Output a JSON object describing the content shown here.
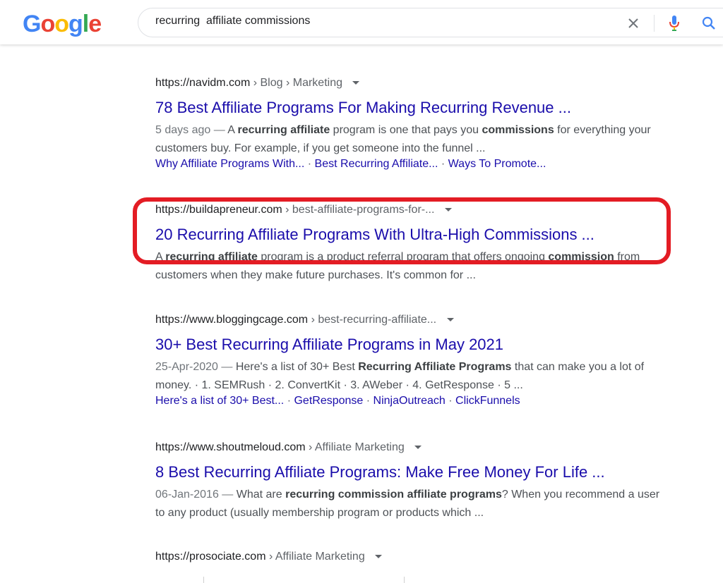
{
  "logo": {
    "letters": [
      "G",
      "o",
      "o",
      "g",
      "l",
      "e"
    ]
  },
  "search": {
    "query": "recurring  affiliate commissions"
  },
  "colors": {
    "link": "#1a0dab",
    "highlight": "#e31c24"
  },
  "results": [
    {
      "url": "https://navidm.com",
      "path": " › Blog › Marketing",
      "title": "78 Best Affiliate Programs For Making Recurring Revenue ...",
      "snippet": [
        {
          "t": "5 days ago — ",
          "date": true
        },
        {
          "t": "A "
        },
        {
          "t": "recurring affiliate",
          "b": true
        },
        {
          "t": " program is one that pays you "
        },
        {
          "t": "commissions",
          "b": true
        },
        {
          "t": " for everything your customers buy. For example, if you get someone into the funnel ..."
        }
      ],
      "sitelinks": [
        "Why Affiliate Programs With...",
        "Best Recurring Affiliate...",
        "Ways To Promote..."
      ]
    },
    {
      "url": "https://buildapreneur.com",
      "path": " › best-affiliate-programs-for-...",
      "title": "20 Recurring Affiliate Programs With Ultra-High Commissions ...",
      "snippet": [
        {
          "t": "A "
        },
        {
          "t": "recurring affiliate",
          "b": true
        },
        {
          "t": " program is a product referral program that offers ongoing "
        },
        {
          "t": "commission",
          "b": true
        },
        {
          "t": " from customers when they make future purchases. It's common for ..."
        }
      ],
      "sitelinks": []
    },
    {
      "url": "https://www.bloggingcage.com",
      "path": " › best-recurring-affiliate...",
      "title": "30+ Best Recurring Affiliate Programs in May 2021",
      "snippet": [
        {
          "t": "25-Apr-2020 — ",
          "date": true
        },
        {
          "t": "Here's a list of 30+ Best "
        },
        {
          "t": "Recurring Affiliate Programs",
          "b": true
        },
        {
          "t": " that can make you a lot of money. · 1. SEMRush · 2. ConvertKit · 3. AWeber · 4. GetResponse · 5 ..."
        }
      ],
      "sitelinks": [
        "Here's a list of 30+ Best...",
        "GetResponse",
        "NinjaOutreach",
        "ClickFunnels"
      ]
    },
    {
      "url": "https://www.shoutmeloud.com",
      "path": " › Affiliate Marketing",
      "title": "8 Best Recurring Affiliate Programs: Make Free Money For Life ...",
      "snippet": [
        {
          "t": "06-Jan-2016 — ",
          "date": true
        },
        {
          "t": "What are "
        },
        {
          "t": "recurring commission affiliate programs",
          "b": true
        },
        {
          "t": "? When you recommend a user to any product (usually membership program or products which ..."
        }
      ],
      "sitelinks": []
    },
    {
      "url": "https://prosociate.com",
      "path": " › Affiliate Marketing",
      "title": "",
      "snippet": [],
      "sitelinks": []
    }
  ]
}
